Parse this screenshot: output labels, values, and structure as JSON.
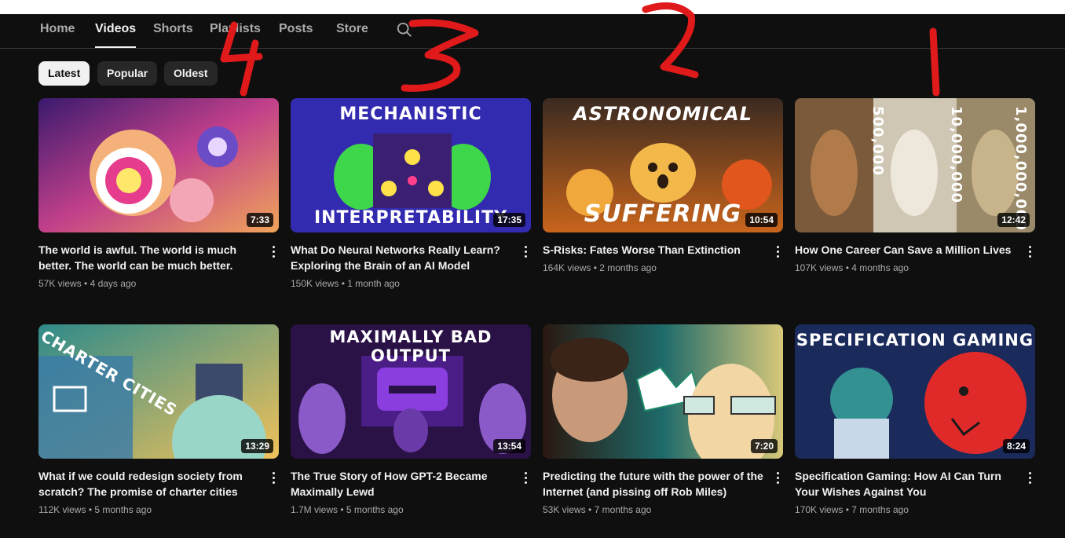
{
  "tabs": [
    "Home",
    "Videos",
    "Shorts",
    "Playlists",
    "Posts",
    "Store"
  ],
  "search_icon": "search-icon",
  "sort_chips": [
    "Latest",
    "Popular",
    "Oldest"
  ],
  "videos": [
    {
      "title": "The world is awful. The world is much better. The world can be much better.",
      "views": "57K views",
      "age": "4 days ago",
      "duration": "7:33",
      "overlay": ""
    },
    {
      "title": "What Do Neural Networks Really Learn? Exploring the Brain of an AI Model",
      "views": "150K views",
      "age": "1 month ago",
      "duration": "17:35",
      "overlay": "MECHANISTIC",
      "overlay2": "INTERPRETABILITY"
    },
    {
      "title": "S-Risks: Fates Worse Than Extinction",
      "views": "164K views",
      "age": "2 months ago",
      "duration": "10:54",
      "overlay": "ASTRONOMICAL",
      "overlay2": "SUFFERING"
    },
    {
      "title": "How One Career Can Save a Million Lives",
      "views": "107K views",
      "age": "4 months ago",
      "duration": "12:42",
      "overlay": "500,000",
      "overlay2": "10,000,000",
      "overlay3": "1,000,000,000"
    },
    {
      "title": "What if we could redesign society from scratch? The promise of charter cities",
      "views": "112K views",
      "age": "5 months ago",
      "duration": "13:29",
      "overlay": "CHARTER CITIES"
    },
    {
      "title": "The True Story of How GPT-2 Became Maximally Lewd",
      "views": "1.7M views",
      "age": "5 months ago",
      "duration": "13:54",
      "overlay": "MAXIMALLY BAD OUTPUT"
    },
    {
      "title": "Predicting the future with the power of the Internet (and pissing off Rob Miles)",
      "views": "53K views",
      "age": "7 months ago",
      "duration": "7:20",
      "overlay": ""
    },
    {
      "title": "Specification Gaming: How AI Can Turn Your Wishes Against You",
      "views": "170K views",
      "age": "7 months ago",
      "duration": "8:24",
      "overlay": "SPECIFICATION GAMING"
    }
  ],
  "annotations": [
    "4",
    "3",
    "2",
    "1"
  ],
  "colors": {
    "background": "#0f0f0f",
    "chip": "#272727",
    "annotation": "#e0191b"
  }
}
